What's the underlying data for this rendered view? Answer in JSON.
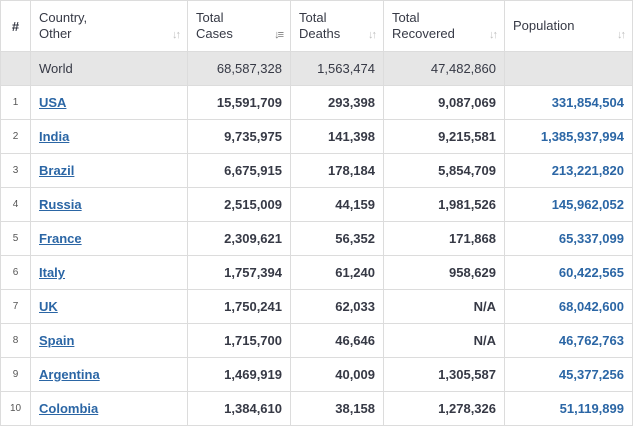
{
  "header": {
    "index": "#",
    "country_line1": "Country,",
    "country_line2": "Other",
    "cases_line1": "Total",
    "cases_line2": "Cases",
    "deaths_line1": "Total",
    "deaths_line2": "Deaths",
    "recovered_line1": "Total",
    "recovered_line2": "Recovered",
    "population": "Population"
  },
  "world": {
    "label": "World",
    "cases": "68,587,328",
    "deaths": "1,563,474",
    "recovered": "47,482,860",
    "population": ""
  },
  "rows": [
    {
      "idx": "1",
      "country": "USA",
      "cases": "15,591,709",
      "deaths": "293,398",
      "recovered": "9,087,069",
      "population": "331,854,504"
    },
    {
      "idx": "2",
      "country": "India",
      "cases": "9,735,975",
      "deaths": "141,398",
      "recovered": "9,215,581",
      "population": "1,385,937,994"
    },
    {
      "idx": "3",
      "country": "Brazil",
      "cases": "6,675,915",
      "deaths": "178,184",
      "recovered": "5,854,709",
      "population": "213,221,820"
    },
    {
      "idx": "4",
      "country": "Russia",
      "cases": "2,515,009",
      "deaths": "44,159",
      "recovered": "1,981,526",
      "population": "145,962,052"
    },
    {
      "idx": "5",
      "country": "France",
      "cases": "2,309,621",
      "deaths": "56,352",
      "recovered": "171,868",
      "population": "65,337,099"
    },
    {
      "idx": "6",
      "country": "Italy",
      "cases": "1,757,394",
      "deaths": "61,240",
      "recovered": "958,629",
      "population": "60,422,565"
    },
    {
      "idx": "7",
      "country": "UK",
      "cases": "1,750,241",
      "deaths": "62,033",
      "recovered": "N/A",
      "population": "68,042,600"
    },
    {
      "idx": "8",
      "country": "Spain",
      "cases": "1,715,700",
      "deaths": "46,646",
      "recovered": "N/A",
      "population": "46,762,763"
    },
    {
      "idx": "9",
      "country": "Argentina",
      "cases": "1,469,919",
      "deaths": "40,009",
      "recovered": "1,305,587",
      "population": "45,377,256"
    },
    {
      "idx": "10",
      "country": "Colombia",
      "cases": "1,384,610",
      "deaths": "38,158",
      "recovered": "1,278,326",
      "population": "51,119,899"
    }
  ],
  "icons": {
    "sort": "sort-arrows-icon"
  },
  "colors": {
    "link": "#2b66a5",
    "world_row_bg": "#e6e6e6",
    "border": "#dcdcdc"
  }
}
